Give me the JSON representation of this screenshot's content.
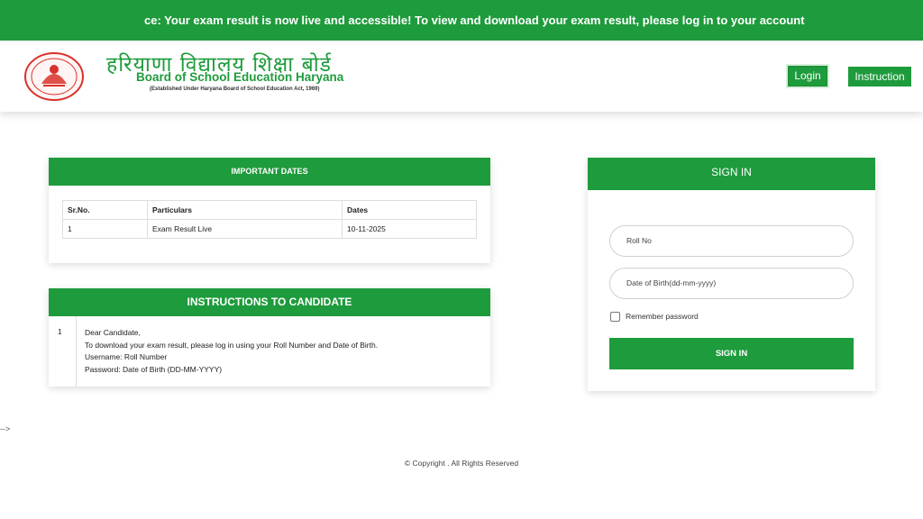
{
  "notice": {
    "text": "ce: Your exam result is now live and accessible! To view and download your exam result, please log in to your account"
  },
  "header": {
    "title_hindi": "हरियाणा विद्यालय शिक्षा बोर्ड",
    "title_english": "Board of School Education Haryana",
    "subtitle": "(Established Under Haryana Board of School Education Act, 1969)",
    "nav": {
      "login": "Login",
      "instruction": "Instruction"
    }
  },
  "important_dates": {
    "heading": "IMPORTANT DATES",
    "columns": [
      "Sr.No.",
      "Particulars",
      "Dates"
    ],
    "rows": [
      {
        "sr": "1",
        "particular": "Exam Result Live",
        "date": "10-11-2025"
      }
    ]
  },
  "instructions": {
    "heading": "INSTRUCTIONS TO CANDIDATE",
    "number": "1",
    "lines": [
      "Dear Candidate,",
      "To download your exam result, please log in using your Roll Number and Date of Birth.",
      "Username: Roll Number",
      "Password: Date of Birth (DD-MM-YYYY)"
    ]
  },
  "signin": {
    "heading": "SIGN IN",
    "roll_placeholder": "Roll No",
    "dob_placeholder": "Date of Birth(dd-mm-yyyy)",
    "remember_label": "Remember password",
    "button": "SIGN IN"
  },
  "stray": "-->",
  "footer": {
    "copyright": "© Copyright . All Rights Reserved"
  },
  "colors": {
    "brand_green": "#1e9b3c",
    "logo_red": "#d9322b"
  }
}
